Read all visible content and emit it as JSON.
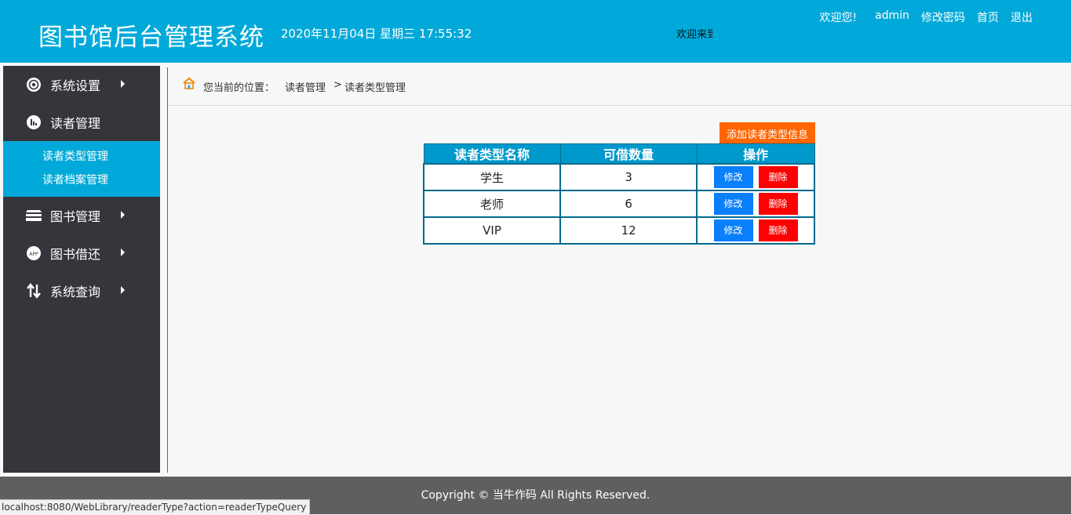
{
  "header": {
    "title": "图书馆后台管理系统",
    "datetime": "2020年11月04日 星期三 17:55:32",
    "marquee": "欢迎来到",
    "welcome": "欢迎您!",
    "user": "admin",
    "change_password": "修改密码",
    "home": "首页",
    "logout": "退出",
    "bg_color": "#00a9d9"
  },
  "sidebar": {
    "items": [
      {
        "label": "系统设置",
        "icon": "gear-icon",
        "has_arrow": true
      },
      {
        "label": "读者管理",
        "icon": "chart-icon",
        "has_arrow": false
      },
      {
        "label": "图书管理",
        "icon": "books-icon",
        "has_arrow": true
      },
      {
        "label": "图书借还",
        "icon": "app-icon",
        "has_arrow": true
      },
      {
        "label": "系统查询",
        "icon": "sort-arrows-icon",
        "has_arrow": true
      }
    ],
    "submenu": [
      {
        "label": "读者类型管理"
      },
      {
        "label": "读者档案管理"
      }
    ]
  },
  "breadcrumb": {
    "label": "您当前的位置：",
    "crumb1": "读者管理",
    "separator": ">",
    "crumb2": "读者类型管理"
  },
  "main": {
    "add_button": "添加读者类型信息",
    "table": {
      "headers": [
        "读者类型名称",
        "可借数量",
        "操作"
      ],
      "rows": [
        {
          "name": "学生",
          "count": "3"
        },
        {
          "name": "老师",
          "count": "6"
        },
        {
          "name": "VIP",
          "count": "12"
        }
      ],
      "edit_label": "修改",
      "delete_label": "删除"
    }
  },
  "footer": {
    "copyright": "Copyright © 当牛作码 All Rights Reserved."
  },
  "statusbar": {
    "url": "localhost:8080/WebLibrary/readerType?action=readerTypeQuery"
  },
  "colors": {
    "accent": "#00a9d9",
    "sidebar_bg": "#35353b",
    "add_button": "#ff6600",
    "edit_button": "#0a7ffb",
    "delete_button": "#ff0000",
    "table_header": "#0099cc",
    "footer_bg": "#5f5f5f"
  }
}
